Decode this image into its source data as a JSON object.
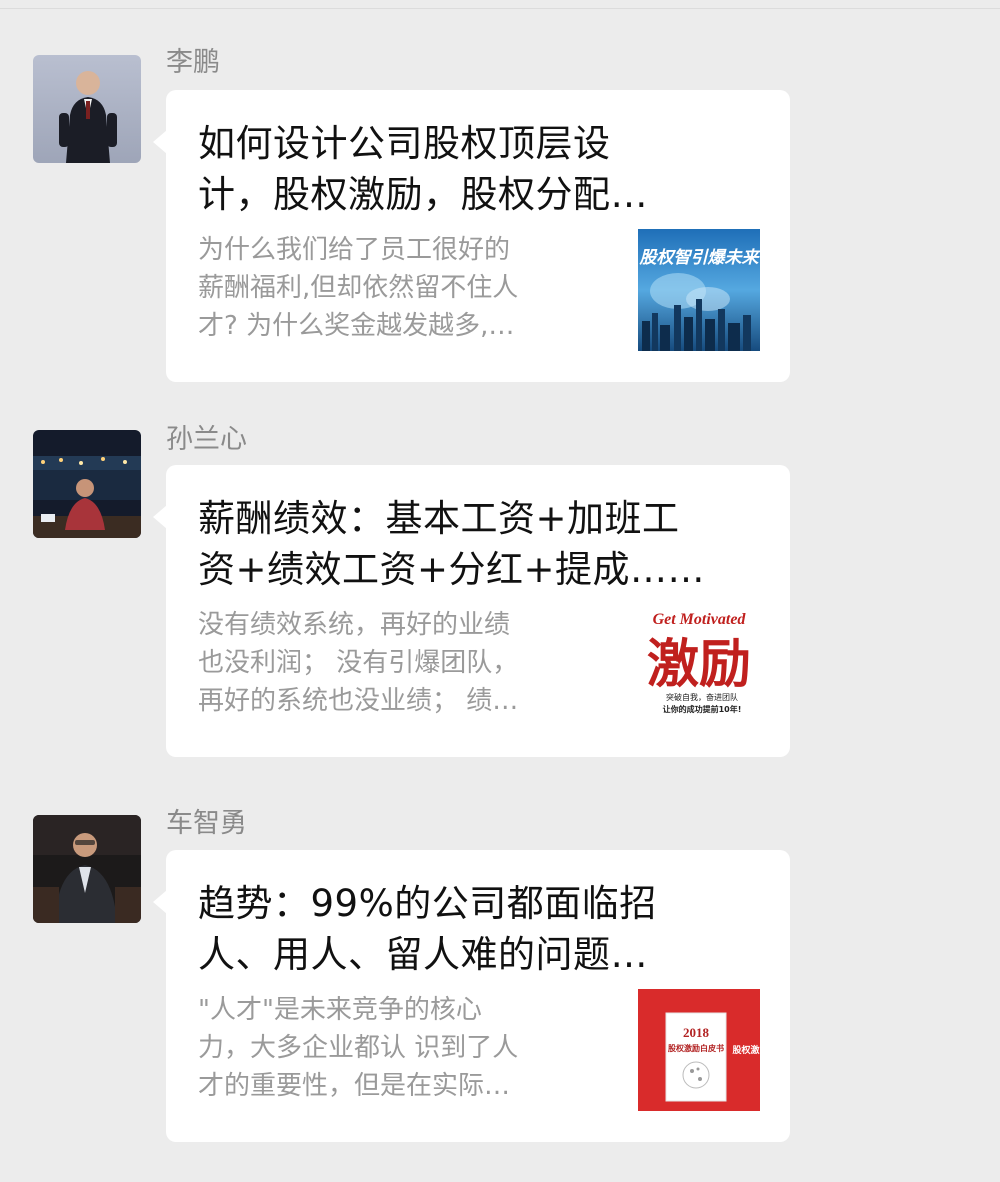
{
  "messages": [
    {
      "sender": "李鹏",
      "title": "如何设计公司股权顶层设\n计，股权激励，股权分配…",
      "description": "为什么我们给了员工很好的\n薪酬福利,但却依然留不住人\n才? 为什么奖金越发越多,…",
      "thumbnail": {
        "text": "股权智引爆未来"
      }
    },
    {
      "sender": "孙兰心",
      "title": "薪酬绩效：基本工资+加班工\n资+绩效工资+分红+提成……",
      "description": "没有绩效系统，再好的业绩\n也没利润； 没有引爆团队，\n再好的系统也没业绩； 绩…",
      "thumbnail": {
        "en_title": "Get Motivated",
        "cn_title": "激励",
        "line1": "突破自我，奋进团队",
        "line2": "让你的成功提前10年!"
      }
    },
    {
      "sender": "车智勇",
      "title": "趋势：99%的公司都面临招\n人、用人、留人难的问题…",
      "description": "\"人才\"是未来竞争的核心\n力，大多企业都认 识到了人\n才的重要性，但是在实际…",
      "thumbnail": {
        "year": "2018",
        "book_title": "股权激励白皮书",
        "side_title": "股权激"
      }
    }
  ],
  "colors": {
    "background": "#ececec",
    "bubble": "#ffffff",
    "title_text": "#111111",
    "desc_text": "#9a9a9a",
    "sender_text": "#8a8a8a"
  }
}
